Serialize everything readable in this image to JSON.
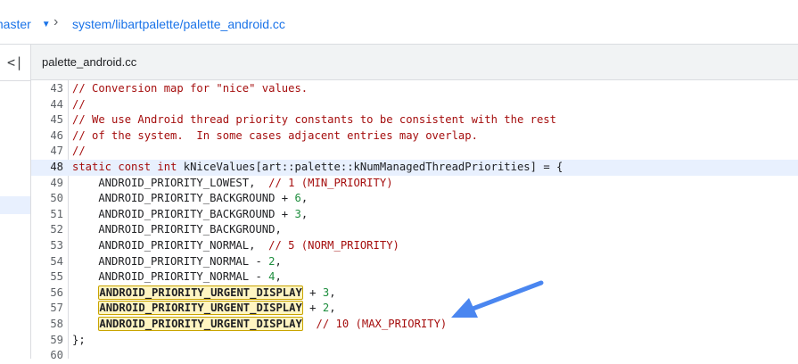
{
  "header": {
    "branch": "master",
    "breadcrumb_separator": "›",
    "path": "system/libartpalette/palette_android.cc"
  },
  "sidebar": {
    "collapse_glyph": "<|"
  },
  "file_tab": {
    "filename": "palette_android.cc"
  },
  "code": {
    "highlighted_line": "48",
    "highlight_token": "ANDROID_PRIORITY_URGENT_DISPLAY",
    "lines": [
      {
        "n": "43",
        "text": "// Conversion map for \"nice\" values."
      },
      {
        "n": "44",
        "text": "//"
      },
      {
        "n": "45",
        "text": "// We use Android thread priority constants to be consistent with the rest"
      },
      {
        "n": "46",
        "text": "// of the system.  In some cases adjacent entries may overlap."
      },
      {
        "n": "47",
        "text": "//"
      },
      {
        "n": "48",
        "text": "static const int kNiceValues[art::palette::kNumManagedThreadPriorities] = {"
      },
      {
        "n": "49",
        "text": "    ANDROID_PRIORITY_LOWEST,  // 1 (MIN_PRIORITY)"
      },
      {
        "n": "50",
        "text": "    ANDROID_PRIORITY_BACKGROUND + 6,"
      },
      {
        "n": "51",
        "text": "    ANDROID_PRIORITY_BACKGROUND + 3,"
      },
      {
        "n": "52",
        "text": "    ANDROID_PRIORITY_BACKGROUND,"
      },
      {
        "n": "53",
        "text": "    ANDROID_PRIORITY_NORMAL,  // 5 (NORM_PRIORITY)"
      },
      {
        "n": "54",
        "text": "    ANDROID_PRIORITY_NORMAL - 2,"
      },
      {
        "n": "55",
        "text": "    ANDROID_PRIORITY_NORMAL - 4,"
      },
      {
        "n": "56",
        "text": "    ANDROID_PRIORITY_URGENT_DISPLAY + 3,"
      },
      {
        "n": "57",
        "text": "    ANDROID_PRIORITY_URGENT_DISPLAY + 2,"
      },
      {
        "n": "58",
        "text": "    ANDROID_PRIORITY_URGENT_DISPLAY  // 10 (MAX_PRIORITY)"
      },
      {
        "n": "59",
        "text": "};"
      },
      {
        "n": "60",
        "text": ""
      }
    ]
  },
  "colors": {
    "link": "#1a73e8",
    "comment": "#a50e0e",
    "number": "#1e8e3e",
    "highlight_bg": "#fff5c2",
    "arrow": "#4285f4"
  }
}
